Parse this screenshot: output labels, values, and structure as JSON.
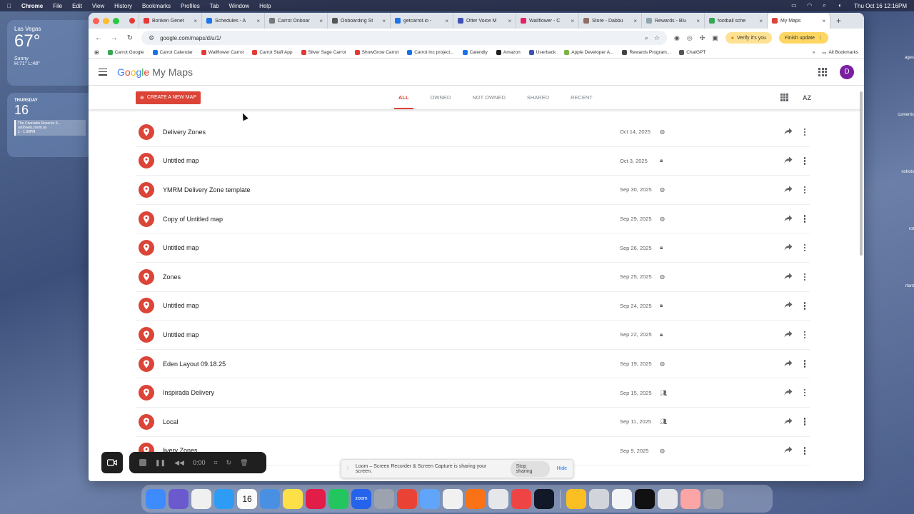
{
  "menubar": {
    "apple": "",
    "app": "Chrome",
    "items": [
      "File",
      "Edit",
      "View",
      "History",
      "Bookmarks",
      "Profiles",
      "Tab",
      "Window",
      "Help"
    ],
    "clock": "Thu Oct 16  12:16PM"
  },
  "widgets": {
    "weather": {
      "city": "Las Vegas",
      "temp": "67°",
      "cond": "Sunny",
      "hilo": "H:71° L:48°"
    },
    "calendar": {
      "day": "Thursday",
      "date": "16",
      "event_title": "The Cannabis Reserve S...",
      "event_sub": "us06web.zoom.us",
      "event_time": "1 - 1:30PM"
    }
  },
  "desktop_right": [
    "ages",
    "cuments",
    "nshots",
    "rot",
    "rtant"
  ],
  "browser": {
    "tabs": [
      {
        "label": "Boriken Genet",
        "color": "#e53935"
      },
      {
        "label": "Schedules - A",
        "color": "#1a73e8"
      },
      {
        "label": "Carrot Onboar",
        "color": "#777"
      },
      {
        "label": "Onboarding St",
        "color": "#555"
      },
      {
        "label": "getcarrot.io -",
        "color": "#1a73e8"
      },
      {
        "label": "Otter Voice M",
        "color": "#3f51b5"
      },
      {
        "label": "Wallflower - C",
        "color": "#e91e63"
      },
      {
        "label": "Store - Dabbu",
        "color": "#8d6e63"
      },
      {
        "label": "Rewards - Blu",
        "color": "#90a4ae"
      },
      {
        "label": "football sche",
        "color": "#34a853"
      },
      {
        "label": "My Maps",
        "color": "#db4437",
        "active": true
      }
    ],
    "url": "google.com/maps/d/u/1/",
    "verify_label": "Verify it's you",
    "finish_label": "Finish update",
    "bookmarks": [
      {
        "label": "Carrot Google",
        "color": "#34a853"
      },
      {
        "label": "Carrot Calendar",
        "color": "#1a73e8"
      },
      {
        "label": "Wallflower Carrot",
        "color": "#e53935"
      },
      {
        "label": "Carrot Staff App",
        "color": "#e53935"
      },
      {
        "label": "Silver Sage Carrot",
        "color": "#e53935"
      },
      {
        "label": "ShowGrow Carrot",
        "color": "#e53935"
      },
      {
        "label": "Carrot Inc project...",
        "color": "#1a73e8"
      },
      {
        "label": "Calendly",
        "color": "#1a73e8"
      },
      {
        "label": "Amazon",
        "color": "#222"
      },
      {
        "label": "Userback",
        "color": "#3f51b5"
      },
      {
        "label": "Apple Developer A...",
        "color": "#7cb342"
      },
      {
        "label": "Rewards Program...",
        "color": "#444"
      },
      {
        "label": "ChatGPT",
        "color": "#555"
      }
    ],
    "all_bookmarks": "All Bookmarks"
  },
  "mymaps": {
    "logo": {
      "g": "G",
      "o1": "o",
      "o2": "o",
      "g2": "g",
      "l": "l",
      "e": "e",
      "product": "My Maps"
    },
    "avatar": "D",
    "create_label": "Create a new map",
    "filters": [
      "All",
      "Owned",
      "Not owned",
      "Shared",
      "Recent"
    ],
    "az_label": "AZ",
    "maps": [
      {
        "name": "Delivery Zones",
        "date": "Oct 14, 2025",
        "vis": "public"
      },
      {
        "name": "Untitled map",
        "date": "Oct 3, 2025",
        "vis": "private"
      },
      {
        "name": "YMRM Delivery Zone template",
        "date": "Sep 30, 2025",
        "vis": "public"
      },
      {
        "name": "Copy of Untitled map",
        "date": "Sep 29, 2025",
        "vis": "public"
      },
      {
        "name": "Untitled map",
        "date": "Sep 26, 2025",
        "vis": "private"
      },
      {
        "name": "Zones",
        "date": "Sep 25, 2025",
        "vis": "public"
      },
      {
        "name": "Untitled map",
        "date": "Sep 24, 2025",
        "vis": "private"
      },
      {
        "name": "Untitled map",
        "date": "Sep 22, 2025",
        "vis": "private"
      },
      {
        "name": "Eden Layout 09.18.25",
        "date": "Sep 19, 2025",
        "vis": "public"
      },
      {
        "name": "Inspirada Delivery",
        "date": "Sep 15, 2025",
        "vis": "shared"
      },
      {
        "name": "Local",
        "date": "Sep 11, 2025",
        "vis": "shared"
      },
      {
        "name": "livery Zones",
        "date": "Sep 9, 2025",
        "vis": "public"
      }
    ]
  },
  "loom": {
    "time": "0:00",
    "message": "Loom – Screen Recorder & Screen Capture is sharing your screen.",
    "stop_label": "Stop sharing",
    "hide_label": "Hide"
  },
  "dock": {
    "calendar_date": "16",
    "zoom_label": "zoom",
    "icons": [
      "#3d8bfd",
      "#6a5acd",
      "#f0f0f0",
      "#2e9cf5",
      "#fafafa",
      "#4a90e2",
      "#fde047",
      "#e11d48",
      "#22c55e",
      "#2563eb",
      "#9ca3af",
      "#ea4335",
      "#60a5fa",
      "#f1f1f1",
      "#f97316",
      "#e5e7eb",
      "#ef4444",
      "#111827",
      "#fbbf24",
      "#d1d5db",
      "#f3f4f6",
      "#111",
      "#e5e7eb",
      "#fca5a5",
      "#9ca3af"
    ]
  }
}
